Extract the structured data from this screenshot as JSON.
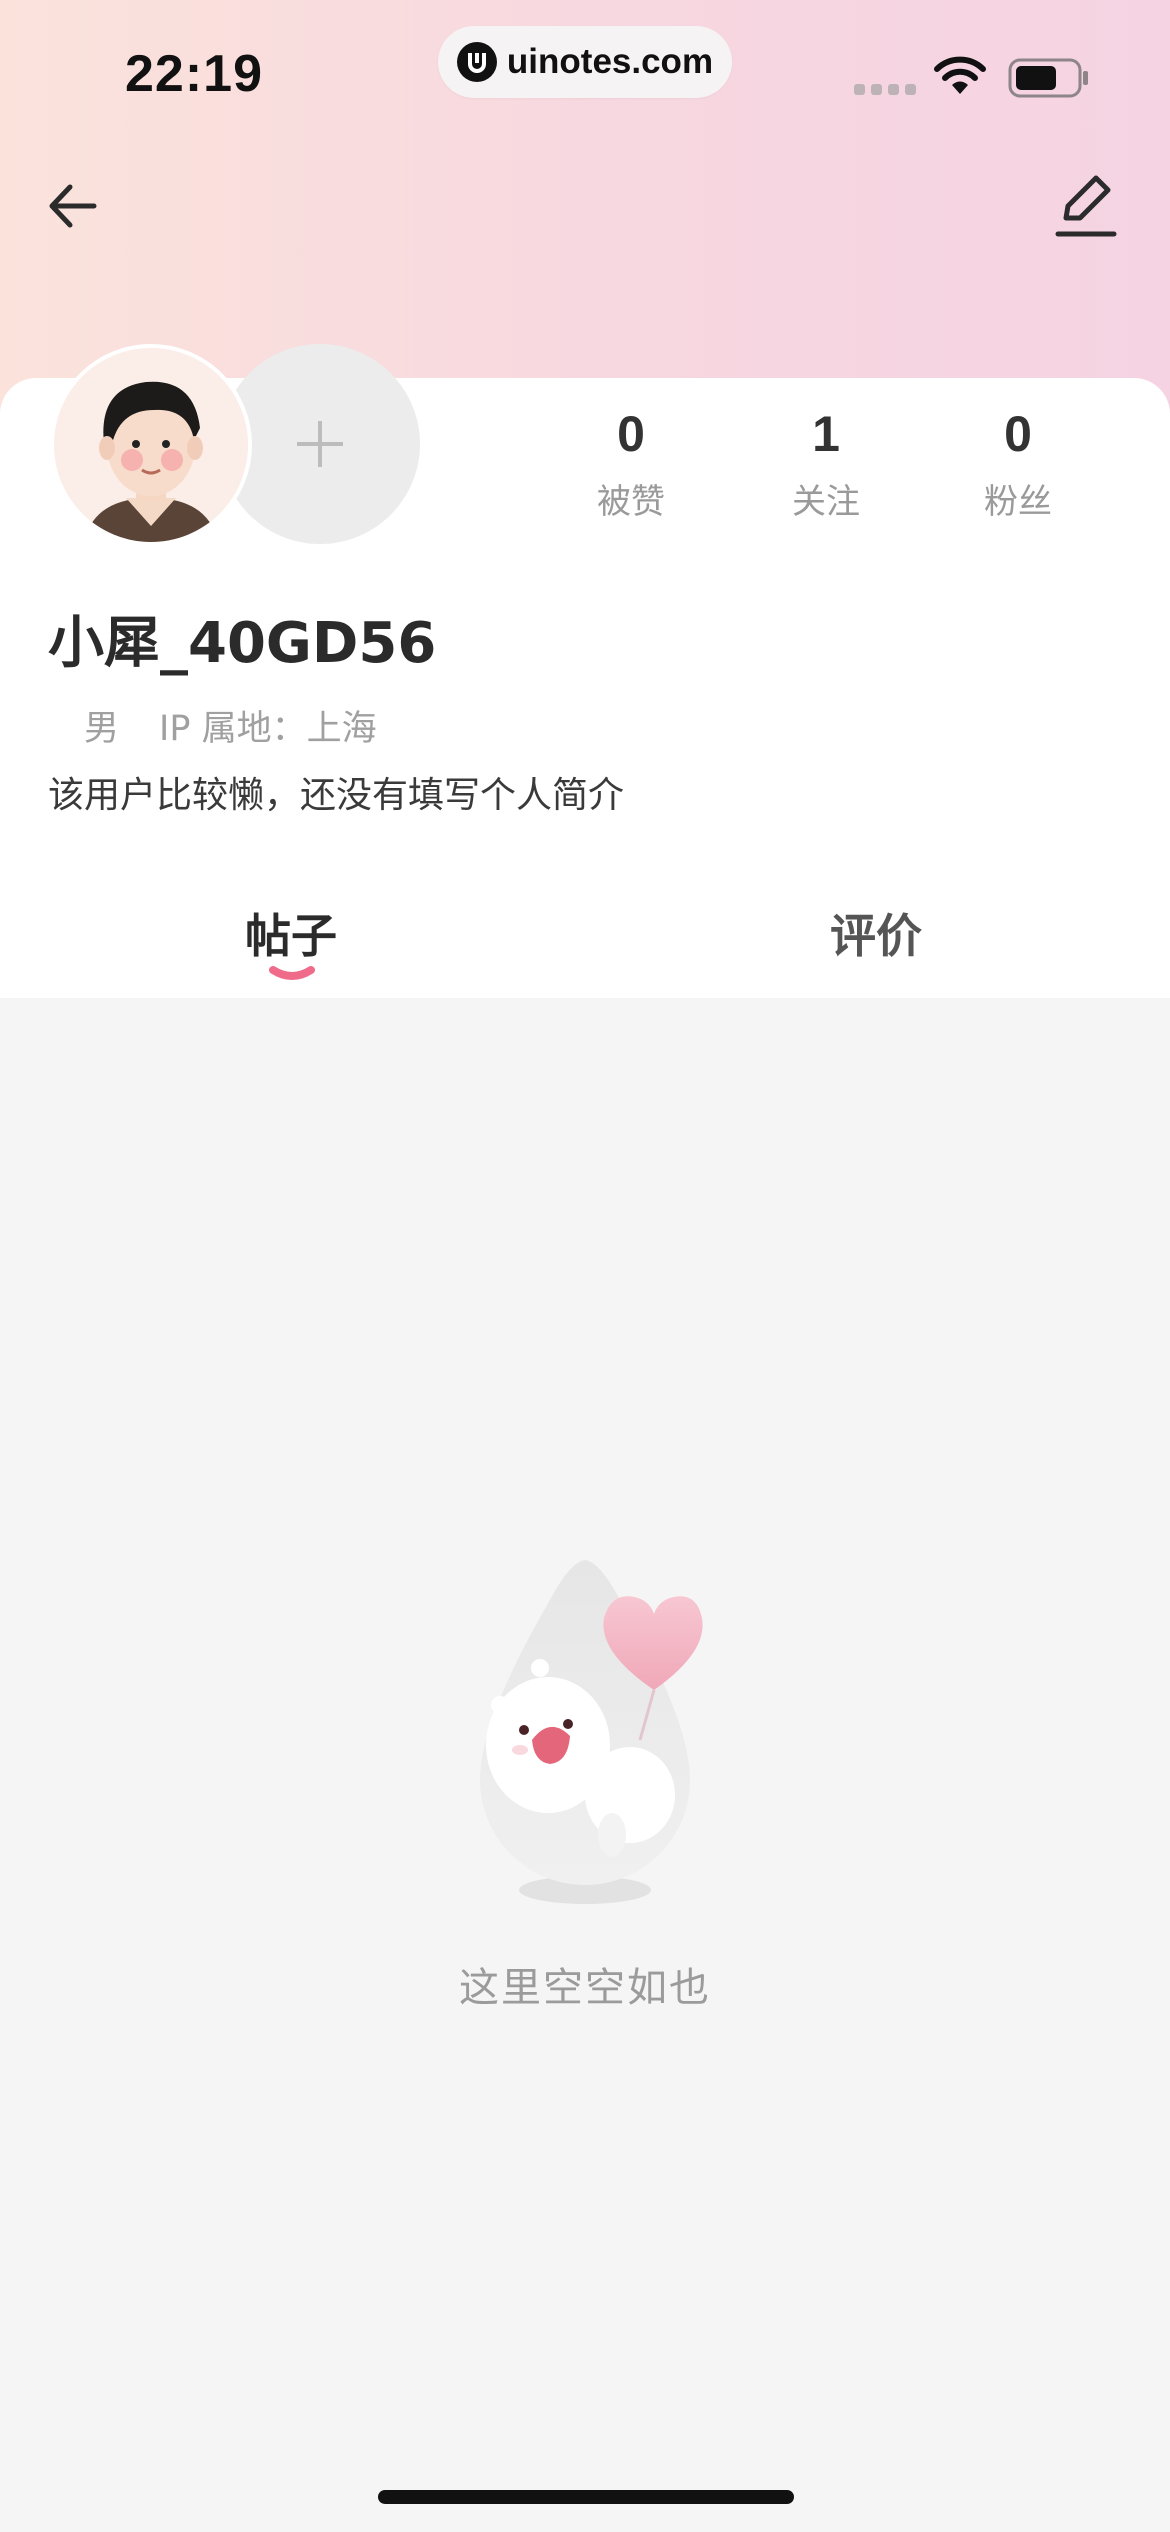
{
  "status_bar": {
    "time": "22:19",
    "url": "uinotes.com"
  },
  "header": {
    "back_icon": "arrow-left-icon",
    "edit_icon": "pencil-icon"
  },
  "profile": {
    "add_avatar_symbol": "+",
    "stats": [
      {
        "value": "0",
        "label": "被赞"
      },
      {
        "value": "1",
        "label": "关注"
      },
      {
        "value": "0",
        "label": "粉丝"
      }
    ],
    "username": "小犀_40GD56",
    "gender": "男",
    "ip_location": "IP 属地：上海",
    "bio": "该用户比较懒，还没有填写个人简介"
  },
  "tabs": [
    {
      "label": "帖子",
      "active": true
    },
    {
      "label": "评价",
      "active": false
    }
  ],
  "empty_state": {
    "text": "这里空空如也"
  },
  "colors": {
    "accent": "#f06a8a",
    "header_gradient_start": "#fbe3dc",
    "header_gradient_end": "#f5d3e3"
  }
}
